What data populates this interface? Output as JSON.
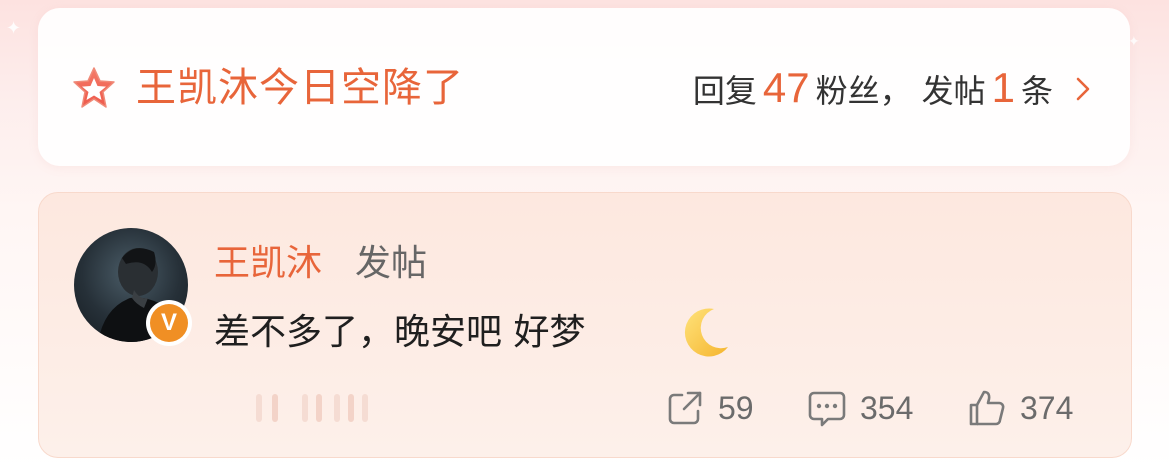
{
  "colors": {
    "accent": "#e8653a",
    "text": "#1f1f1f",
    "muted": "#6b6b6b",
    "badge": "#f08f24"
  },
  "banner": {
    "title": "王凯沐今日空降了",
    "reply_label": "回复",
    "reply_count": "47",
    "fans_label": "粉丝，",
    "post_label": "发帖",
    "post_count": "1",
    "post_unit": "条",
    "icon": "star-badge-icon",
    "chevron": "chevron-right-icon"
  },
  "post": {
    "author": "王凯沐",
    "action": "发帖",
    "verified_mark": "V",
    "text": "差不多了，晚安吧 好梦",
    "emoji": "crescent-moon-icon",
    "stats": {
      "shares": "59",
      "comments": "354",
      "likes": "374"
    }
  }
}
